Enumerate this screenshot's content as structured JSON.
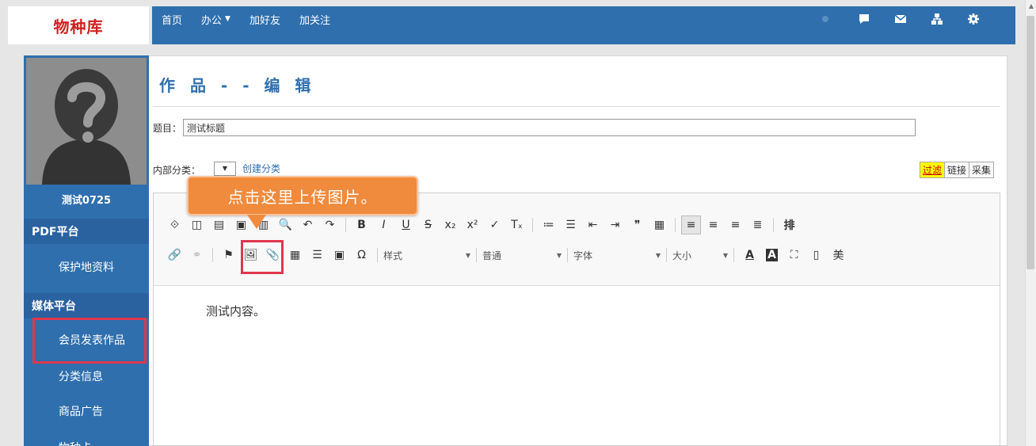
{
  "brand": "物种库",
  "nav": {
    "items": [
      "首页",
      "办公",
      "加好友",
      "加关注"
    ],
    "icons": [
      "chat-icon",
      "mail-icon",
      "sitemap-icon",
      "gear-icon"
    ]
  },
  "sidebar": {
    "username": "测试0725",
    "sections": [
      {
        "title": "PDF平台",
        "items": [
          "保护地资料"
        ]
      },
      {
        "title": "媒体平台",
        "items": [
          "会员发表作品",
          "分类信息",
          "商品广告",
          "物种卡"
        ]
      }
    ]
  },
  "main": {
    "page_title": "作 品 - - 编 辑",
    "title_label": "题目：",
    "title_value": "测试标题",
    "category_label": "内部分类：",
    "category_value": "",
    "create_category_link": "创建分类",
    "tag_buttons": [
      "过滤",
      "链接",
      "采集"
    ],
    "callout_text": "点击这里上传图片。",
    "editor_content": "测试内容。"
  },
  "toolbar": {
    "row1": [
      {
        "name": "source-icon",
        "glyph": "⟐"
      },
      {
        "name": "preview-icon",
        "glyph": "◫"
      },
      {
        "name": "template-icon",
        "glyph": "▤"
      },
      {
        "name": "paste-icon",
        "glyph": "▣"
      },
      {
        "name": "paste-word-icon",
        "glyph": "▥"
      },
      {
        "name": "find-icon",
        "glyph": "🔍"
      },
      {
        "name": "undo-icon",
        "glyph": "↶"
      },
      {
        "name": "redo-icon",
        "glyph": "↷"
      },
      {
        "name": "bold-icon",
        "glyph": "B"
      },
      {
        "name": "italic-icon",
        "glyph": "I"
      },
      {
        "name": "underline-icon",
        "glyph": "U"
      },
      {
        "name": "strike-icon",
        "glyph": "S"
      },
      {
        "name": "subscript-icon",
        "glyph": "x₂"
      },
      {
        "name": "superscript-icon",
        "glyph": "x²"
      },
      {
        "name": "format-painter-icon",
        "glyph": "✓"
      },
      {
        "name": "clear-format-icon",
        "glyph": "Tₓ"
      },
      {
        "name": "ordered-list-icon",
        "glyph": "≔"
      },
      {
        "name": "bulleted-list-icon",
        "glyph": "☰"
      },
      {
        "name": "outdent-icon",
        "glyph": "⇤"
      },
      {
        "name": "indent-icon",
        "glyph": "⇥"
      },
      {
        "name": "blockquote-icon",
        "glyph": "❞"
      },
      {
        "name": "div-icon",
        "glyph": "▦"
      },
      {
        "name": "align-left-icon",
        "glyph": "≡"
      },
      {
        "name": "align-center-icon",
        "glyph": "≡"
      },
      {
        "name": "align-right-icon",
        "glyph": "≡"
      },
      {
        "name": "justify-icon",
        "glyph": "≣"
      },
      {
        "name": "typesetting-icon",
        "glyph": "排"
      }
    ],
    "row2_icons": [
      {
        "name": "link-icon",
        "glyph": "🔗"
      },
      {
        "name": "unlink-icon",
        "glyph": "⚭"
      },
      {
        "name": "anchor-flag-icon",
        "glyph": "⚑"
      },
      {
        "name": "image-icon",
        "glyph": "🖼"
      },
      {
        "name": "attachment-icon",
        "glyph": "📎"
      },
      {
        "name": "table-icon",
        "glyph": "▦"
      },
      {
        "name": "horizontal-line-icon",
        "glyph": "☰"
      },
      {
        "name": "media-icon",
        "glyph": "▣"
      },
      {
        "name": "special-char-icon",
        "glyph": "Ω"
      }
    ],
    "combos": [
      "样式",
      "普通",
      "字体",
      "大小"
    ],
    "row2_tail": [
      {
        "name": "text-color-icon",
        "glyph": "A"
      },
      {
        "name": "bg-color-icon",
        "glyph": "A"
      },
      {
        "name": "maximize-icon",
        "glyph": "⛶"
      },
      {
        "name": "show-blocks-icon",
        "glyph": "▯"
      },
      {
        "name": "beautify-icon",
        "glyph": "美"
      }
    ]
  },
  "colors": {
    "nav": "#2f6fad",
    "brand_red": "#d21f1f",
    "callout": "#f08a3c",
    "highlight": "#e0374e",
    "tag_active": "#ffff00"
  }
}
